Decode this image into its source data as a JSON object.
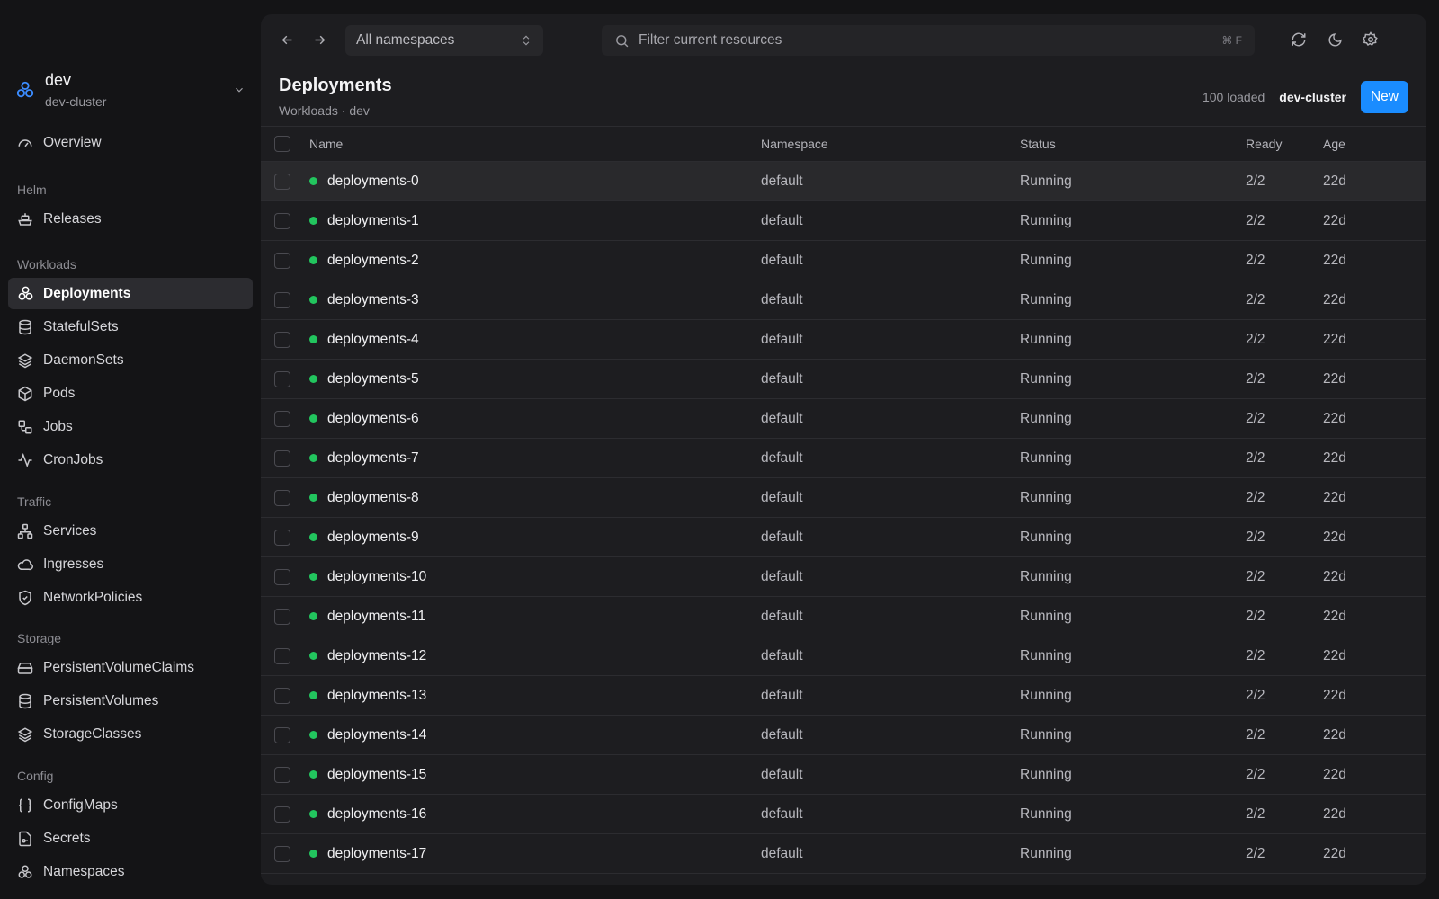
{
  "colors": {
    "accent": "#1a8cff",
    "status_running": "#22c55e"
  },
  "cluster": {
    "name": "dev",
    "subtitle": "dev-cluster",
    "icon": "cluster-icon"
  },
  "nav": {
    "overview": "Overview",
    "sections": {
      "helm": "Helm",
      "workloads": "Workloads",
      "traffic": "Traffic",
      "storage": "Storage",
      "config": "Config"
    },
    "items": {
      "releases": "Releases",
      "deployments": "Deployments",
      "statefulsets": "StatefulSets",
      "daemonsets": "DaemonSets",
      "pods": "Pods",
      "jobs": "Jobs",
      "cronjobs": "CronJobs",
      "services": "Services",
      "ingresses": "Ingresses",
      "networkpolicies": "NetworkPolicies",
      "pvcs": "PersistentVolumeClaims",
      "pvs": "PersistentVolumes",
      "storageclasses": "StorageClasses",
      "configmaps": "ConfigMaps",
      "secrets": "Secrets",
      "namespaces": "Namespaces"
    },
    "active": "deployments"
  },
  "toolbar": {
    "namespace_selected": "All namespaces",
    "search_placeholder": "Filter current resources",
    "search_shortcut": "⌘ F"
  },
  "page": {
    "title": "Deployments",
    "breadcrumb": "Workloads · dev",
    "loaded": "100 loaded",
    "context": "dev-cluster",
    "new_label": "New"
  },
  "table": {
    "columns": {
      "name": "Name",
      "namespace": "Namespace",
      "status": "Status",
      "ready": "Ready",
      "age": "Age"
    },
    "rows": [
      {
        "name": "deployments-0",
        "namespace": "default",
        "status": "Running",
        "ready": "2/2",
        "age": "22d"
      },
      {
        "name": "deployments-1",
        "namespace": "default",
        "status": "Running",
        "ready": "2/2",
        "age": "22d"
      },
      {
        "name": "deployments-2",
        "namespace": "default",
        "status": "Running",
        "ready": "2/2",
        "age": "22d"
      },
      {
        "name": "deployments-3",
        "namespace": "default",
        "status": "Running",
        "ready": "2/2",
        "age": "22d"
      },
      {
        "name": "deployments-4",
        "namespace": "default",
        "status": "Running",
        "ready": "2/2",
        "age": "22d"
      },
      {
        "name": "deployments-5",
        "namespace": "default",
        "status": "Running",
        "ready": "2/2",
        "age": "22d"
      },
      {
        "name": "deployments-6",
        "namespace": "default",
        "status": "Running",
        "ready": "2/2",
        "age": "22d"
      },
      {
        "name": "deployments-7",
        "namespace": "default",
        "status": "Running",
        "ready": "2/2",
        "age": "22d"
      },
      {
        "name": "deployments-8",
        "namespace": "default",
        "status": "Running",
        "ready": "2/2",
        "age": "22d"
      },
      {
        "name": "deployments-9",
        "namespace": "default",
        "status": "Running",
        "ready": "2/2",
        "age": "22d"
      },
      {
        "name": "deployments-10",
        "namespace": "default",
        "status": "Running",
        "ready": "2/2",
        "age": "22d"
      },
      {
        "name": "deployments-11",
        "namespace": "default",
        "status": "Running",
        "ready": "2/2",
        "age": "22d"
      },
      {
        "name": "deployments-12",
        "namespace": "default",
        "status": "Running",
        "ready": "2/2",
        "age": "22d"
      },
      {
        "name": "deployments-13",
        "namespace": "default",
        "status": "Running",
        "ready": "2/2",
        "age": "22d"
      },
      {
        "name": "deployments-14",
        "namespace": "default",
        "status": "Running",
        "ready": "2/2",
        "age": "22d"
      },
      {
        "name": "deployments-15",
        "namespace": "default",
        "status": "Running",
        "ready": "2/2",
        "age": "22d"
      },
      {
        "name": "deployments-16",
        "namespace": "default",
        "status": "Running",
        "ready": "2/2",
        "age": "22d"
      },
      {
        "name": "deployments-17",
        "namespace": "default",
        "status": "Running",
        "ready": "2/2",
        "age": "22d"
      }
    ]
  }
}
